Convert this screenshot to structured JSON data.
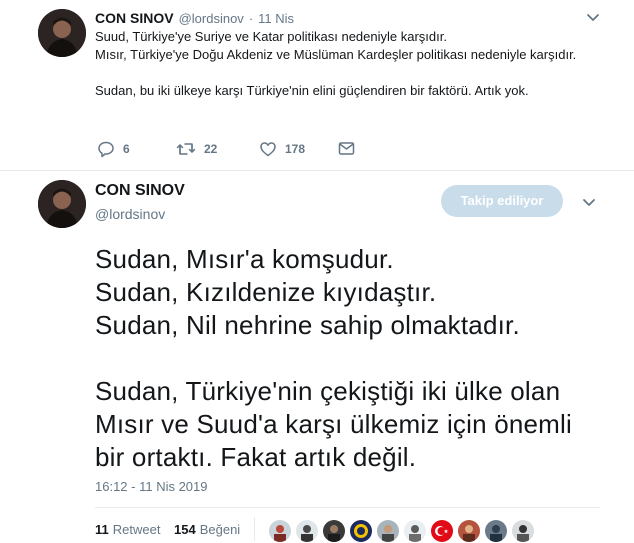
{
  "tweet1": {
    "name": "CON SINOV",
    "handle": "@lordsinov",
    "sep": "·",
    "date": "11 Nis",
    "text": "Suud, Türkiye'ye Suriye ve Katar politikası nedeniyle karşıdır.\nMısır, Türkiye'ye Doğu Akdeniz ve Müslüman Kardeşler politikası nedeniyle karşıdır.\n\nSudan, bu iki ülkeye karşı Türkiye'nin elini güçlendiren bir faktörü. Artık yok.",
    "replies": "6",
    "retweets": "22",
    "likes": "178"
  },
  "tweet2": {
    "name": "CON SINOV",
    "handle": "@lordsinov",
    "follow_label": "Takip ediliyor",
    "text": "Sudan, Mısır'a komşudur.\nSudan, Kızıldenize kıyıdaştır.\nSudan, Nil nehrine sahip olmaktadır.\n\nSudan, Türkiye'nin çekiştiği iki ülke olan Mısır ve Suud'a karşı ülkemiz için önemli bir ortaktı. Fakat artık değil.",
    "timestamp": "16:12 - 11 Nis 2019",
    "retweet_count": "11",
    "retweet_label": "Retweet",
    "like_count": "154",
    "like_label": "Beğeni"
  },
  "icons": {
    "reply": "reply-icon",
    "retweet": "retweet-icon",
    "like": "heart-icon",
    "dm": "mail-icon",
    "caret": "chevron-down-icon"
  },
  "colors": {
    "text": "#14171a",
    "secondary": "#657786",
    "follow_button": "#c9dcea",
    "divider": "#e6ecf0"
  }
}
